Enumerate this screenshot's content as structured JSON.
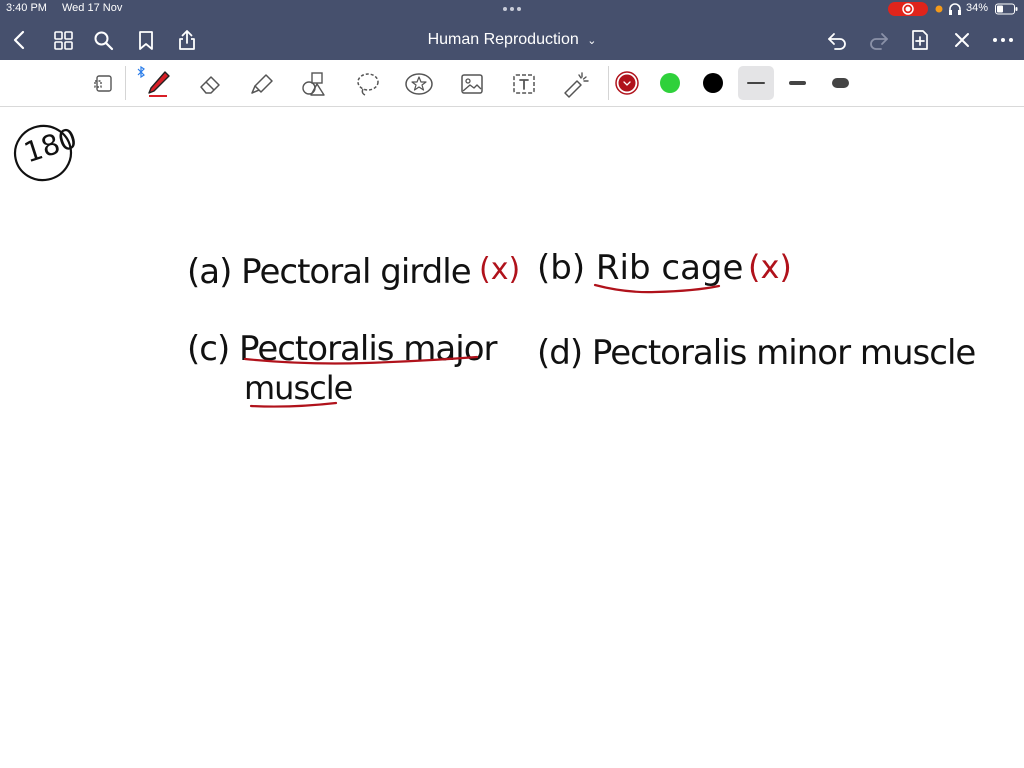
{
  "status_bar": {
    "time": "3:40 PM",
    "date": "Wed 17 Nov",
    "battery": "34%"
  },
  "nav": {
    "title": "Human Reproduction",
    "icons": [
      "back-icon",
      "grid-icon",
      "search-icon",
      "bookmark-icon",
      "share-icon",
      "undo-icon",
      "redo-icon",
      "add-page-icon",
      "close-icon",
      "more-icon"
    ]
  },
  "toolbar": {
    "tools": [
      "lasso-page-icon",
      "pen-icon",
      "eraser-icon",
      "highlighter-icon",
      "shapes-icon",
      "lasso-icon",
      "sticker-icon",
      "image-icon",
      "text-icon",
      "laser-pointer-icon"
    ],
    "colors": [
      "#b0121b",
      "#2fd13b",
      "#000000"
    ],
    "accent": "#46506d"
  },
  "notes": {
    "question_number": "180",
    "option_a": "(a) Pectoral girdle",
    "mark_a": "(x)",
    "option_b": "(b) Rib cage",
    "mark_b": "(x)",
    "option_c_line1": "(c) Pectoralis major",
    "option_c_line2": "muscle",
    "option_d": "(d) Pectoralis minor muscle"
  }
}
